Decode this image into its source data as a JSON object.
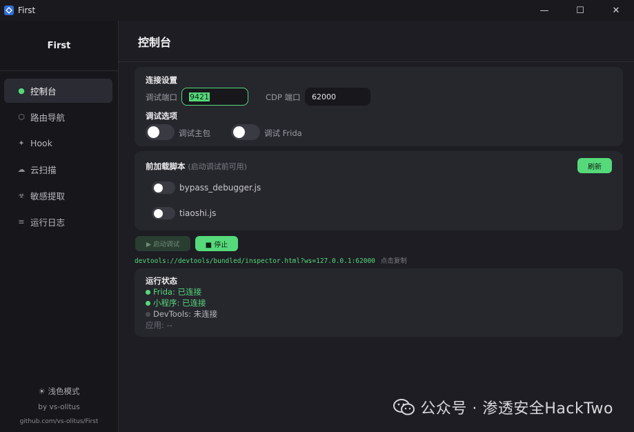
{
  "window": {
    "title": "First",
    "minimize": "—",
    "maximize": "☐",
    "close": "✕"
  },
  "sidebar": {
    "brand": "First",
    "items": [
      {
        "icon": "dot-icon",
        "glyph": "●",
        "label": "控制台",
        "active": true
      },
      {
        "icon": "hexagon-icon",
        "glyph": "⬡",
        "label": "路由导航",
        "active": false
      },
      {
        "icon": "sparkle-icon",
        "glyph": "✦",
        "label": "Hook",
        "active": false
      },
      {
        "icon": "cloud-icon",
        "glyph": "☁",
        "label": "云扫描",
        "active": false
      },
      {
        "icon": "biohazard-icon",
        "glyph": "☣",
        "label": "敏感提取",
        "active": false
      },
      {
        "icon": "list-icon",
        "glyph": "≡",
        "label": "运行日志",
        "active": false
      }
    ],
    "theme_toggle": "☀  浅色模式",
    "author": "by vs-olitus",
    "repo": "github.com/vs-olitus/First"
  },
  "main": {
    "page_title": "控制台",
    "connection": {
      "title": "连接设置",
      "debug_port_label": "调试端口",
      "debug_port_value": "9421",
      "cdp_port_label": "CDP 端口",
      "cdp_port_value": "62000",
      "options_title": "调试选项",
      "opt_main_label": "调试主包",
      "opt_frida_label": "调试 Frida"
    },
    "preload": {
      "title": "前加载脚本",
      "hint": "(启动调试前可用)",
      "refresh_label": "刷新",
      "scripts": [
        "bypass_debugger.js",
        "tiaoshi.js"
      ]
    },
    "actions": {
      "start_label": "▶  启动调试",
      "stop_label": "■  停止",
      "devtools_url": "devtools://devtools/bundled/inspector.html?ws=127.0.0.1:62000",
      "copy_hint": "点击复制"
    },
    "status": {
      "title": "运行状态",
      "frida": "Frida: 已连接",
      "miniprogram": "小程序: 已连接",
      "devtools": "DevTools: 未连接",
      "app": "应用: --"
    }
  },
  "watermark": {
    "text": "公众号 · 渗透安全HackTwo"
  },
  "colors": {
    "accent": "#56d97a",
    "background": "#1d1d23",
    "sidebar": "#17171b",
    "card": "#26262d",
    "disconnected": "#5a5a62"
  }
}
